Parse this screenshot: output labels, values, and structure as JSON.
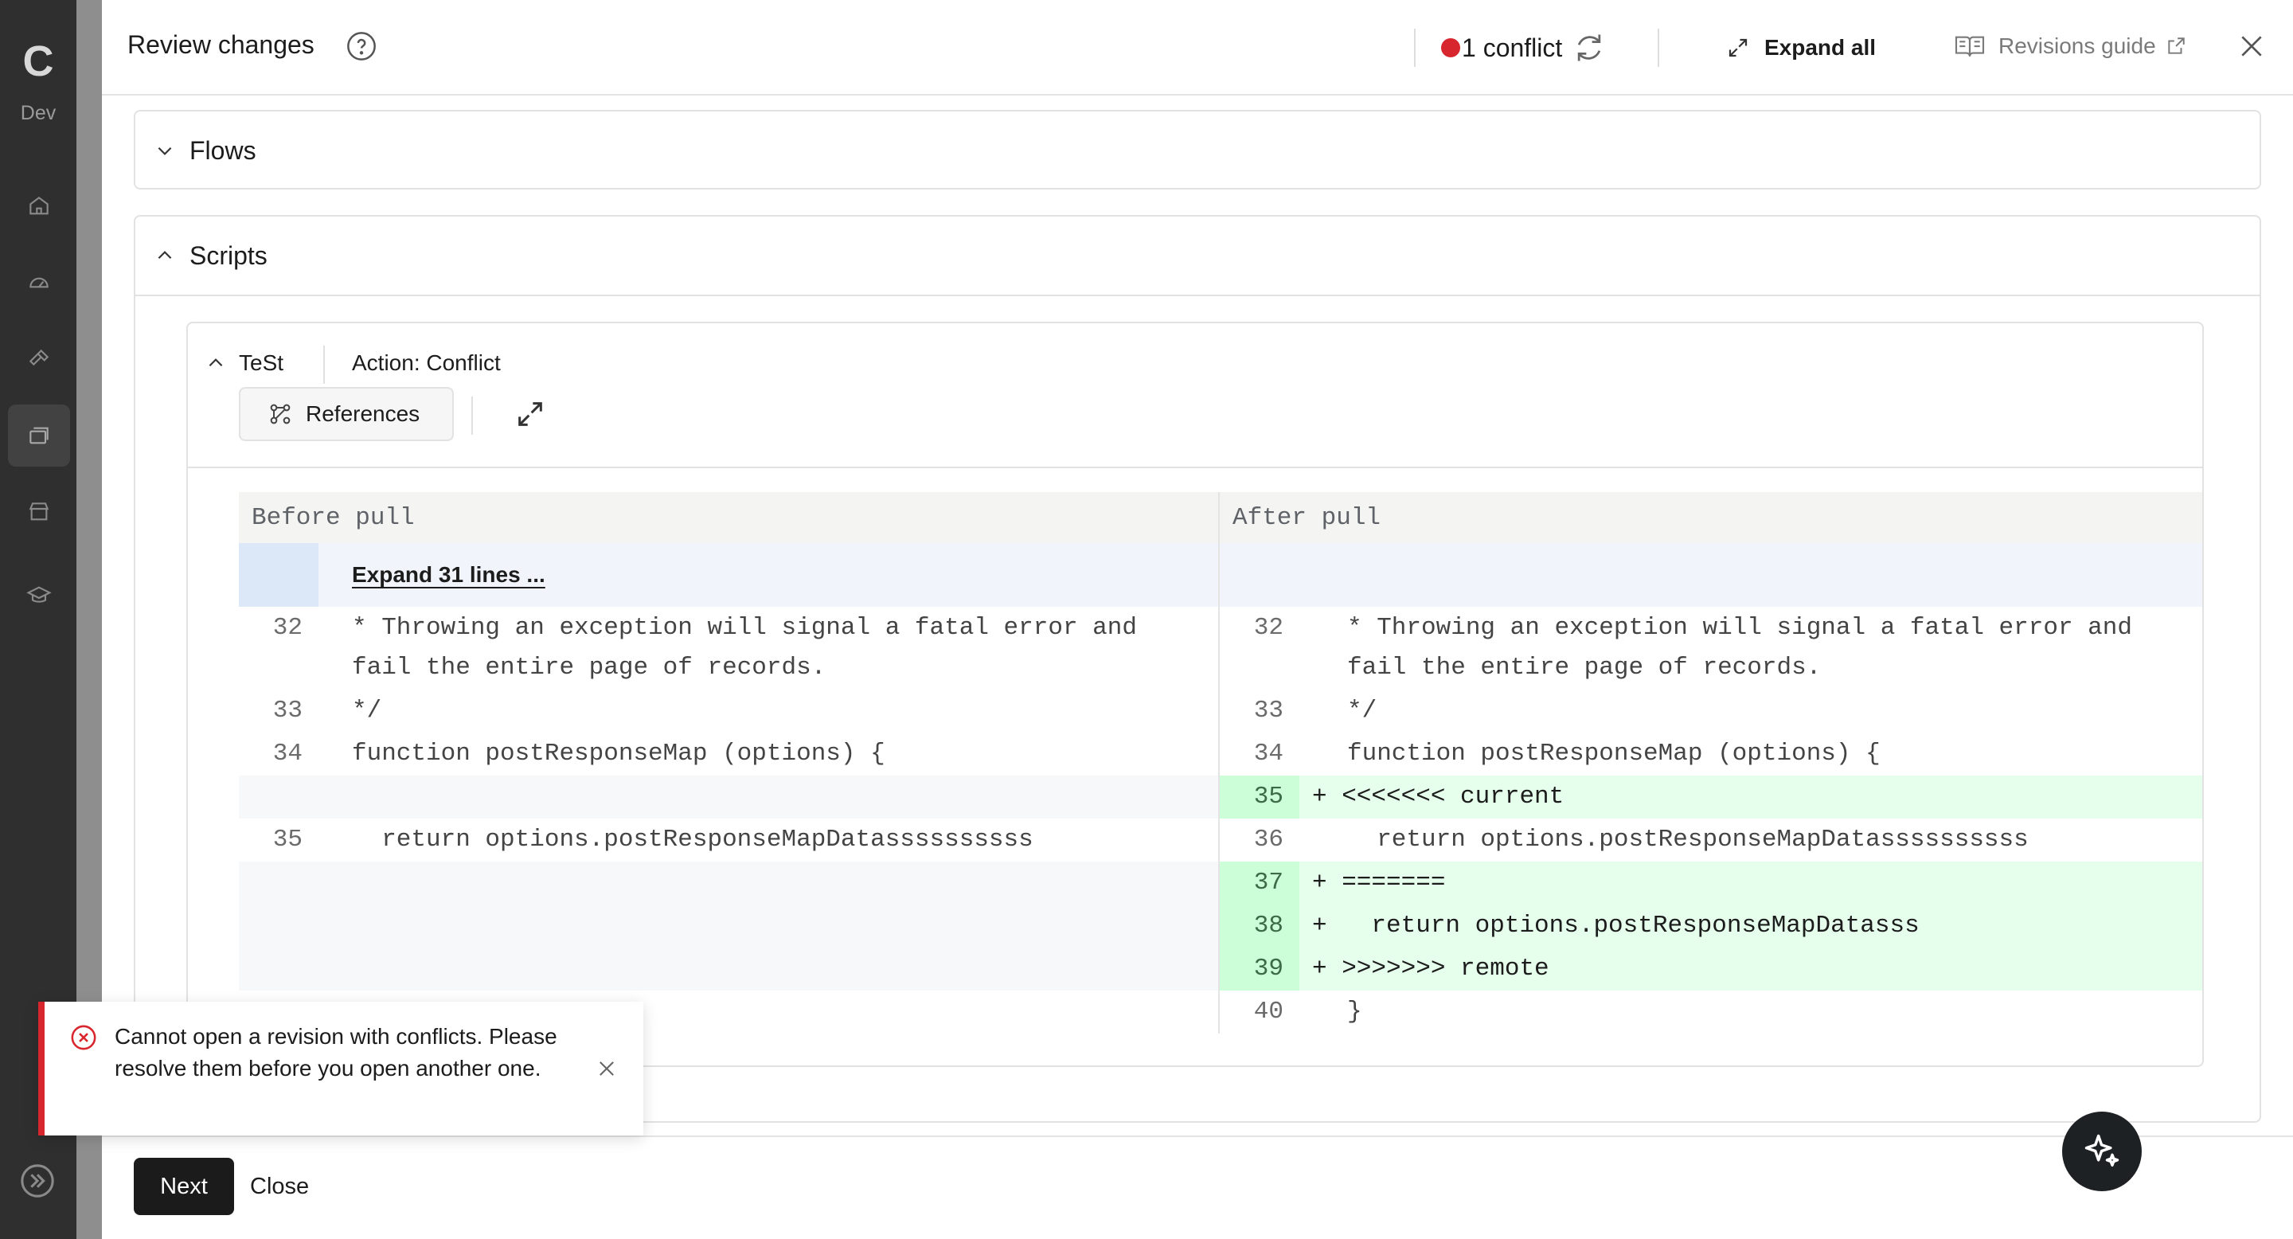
{
  "nav": {
    "logo": "C",
    "env": "Dev",
    "items": [
      {
        "icon": "home-icon"
      },
      {
        "icon": "dashboard-icon"
      },
      {
        "icon": "tools-icon"
      },
      {
        "icon": "resources-icon"
      },
      {
        "icon": "marketplace-icon"
      },
      {
        "icon": "learning-icon"
      }
    ]
  },
  "header": {
    "title": "Review changes",
    "conflict_label": "1 conflict",
    "expand_all": "Expand all",
    "revisions_guide": "Revisions guide"
  },
  "sections": {
    "flows": "Flows",
    "scripts": "Scripts"
  },
  "script_card": {
    "name": "TeSt",
    "action": "Action: Conflict",
    "references_label": "References"
  },
  "diff": {
    "before_label": "Before pull",
    "after_label": "After pull",
    "expand_label": "Expand 31 lines ...",
    "left": [
      {
        "n": "32",
        "text": "* Throwing an exception will signal a fatal error and"
      },
      {
        "n": "",
        "text": "fail the entire page of records."
      },
      {
        "n": "33",
        "text": "*/"
      },
      {
        "n": "34",
        "text": "function postResponseMap (options) {"
      },
      {
        "n": "35",
        "text": "  return options.postResponseMapDatassssssssss"
      }
    ],
    "right": [
      {
        "n": "32",
        "text": "* Throwing an exception will signal a fatal error and"
      },
      {
        "n": "",
        "text": "fail the entire page of records."
      },
      {
        "n": "33",
        "text": "*/"
      },
      {
        "n": "34",
        "text": "function postResponseMap (options) {"
      },
      {
        "n": "35",
        "text": "+ <<<<<<< current"
      },
      {
        "n": "36",
        "text": "  return options.postResponseMapDatassssssssss"
      },
      {
        "n": "37",
        "text": "+ ======="
      },
      {
        "n": "38",
        "text": "+   return options.postResponseMapDatasss"
      },
      {
        "n": "39",
        "text": "+ >>>>>>> remote"
      },
      {
        "n": "40",
        "text": "}"
      }
    ]
  },
  "toast": {
    "message": "Cannot open a revision with conflicts. Please resolve them before you open another one."
  },
  "footer": {
    "next": "Next",
    "close": "Close"
  },
  "colors": {
    "conflict_red": "#d8262e",
    "added_green": "#e6ffec",
    "added_gutter_green": "#ccffd8",
    "expand_blue": "#f1f5fb"
  }
}
